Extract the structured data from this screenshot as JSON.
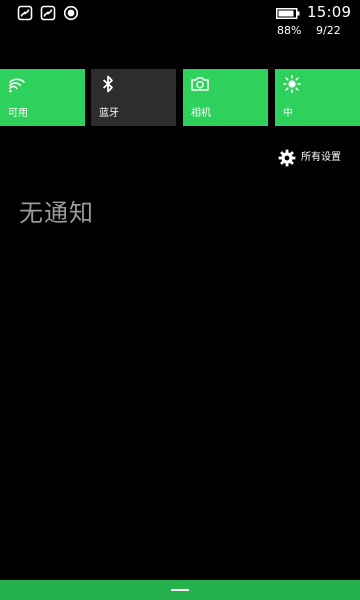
{
  "status_bar": {
    "icons": [
      "notification-app-icon",
      "notification-app-icon",
      "record-icon"
    ],
    "battery_icon": "battery-icon",
    "time": "15:09",
    "battery_percent": "88%",
    "date": "9/22"
  },
  "quick_actions": [
    {
      "label": "可用",
      "icon": "wifi-icon",
      "state": "on"
    },
    {
      "label": "蓝牙",
      "icon": "bluetooth-icon",
      "state": "off"
    },
    {
      "label": "相机",
      "icon": "camera-icon",
      "state": "on"
    },
    {
      "label": "中",
      "icon": "brightness-icon",
      "state": "on"
    }
  ],
  "all_settings": {
    "label": "所有设置",
    "icon": "gear-icon"
  },
  "notifications": {
    "empty_text": "无通知"
  },
  "colors": {
    "accent": "#2fd15d",
    "tile_off": "#2d2d2d",
    "background": "#000000",
    "muted_text": "#9a9a9a",
    "bottom_bar": "#25b24c"
  }
}
